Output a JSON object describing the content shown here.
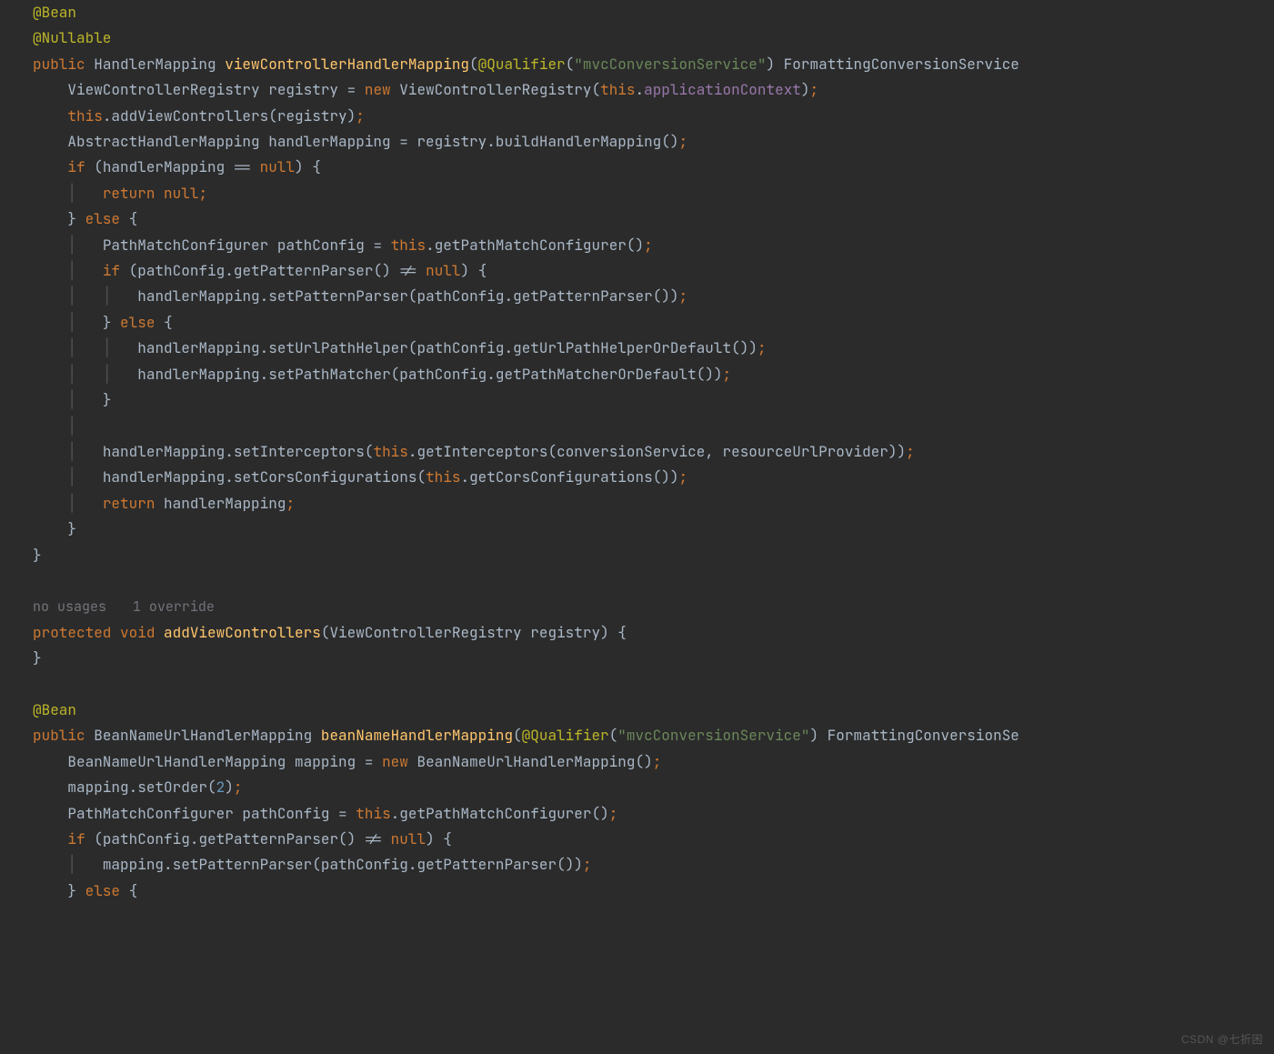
{
  "watermark": "CSDN @七折困",
  "hints": {
    "usages": "no usages",
    "overrides": "1 override"
  },
  "code": {
    "l1": {
      "ann": "@Bean"
    },
    "l2": {
      "ann": "@Nullable"
    },
    "l3": {
      "kw": "public",
      "ty1": "HandlerMapping",
      "fn": "viewControllerHandlerMapping",
      "ann": "@Qualifier",
      "str": "\"mvcConversionService\"",
      "tail": "FormattingConversionService"
    },
    "l4": {
      "ty": "ViewControllerRegistry",
      "var": "registry",
      "op": "=",
      "kw": "new",
      "ctor": "ViewControllerRegistry",
      "kw2": "this",
      "fld": "applicationContext"
    },
    "l5": {
      "kw": "this",
      "call": "addViewControllers",
      "arg": "registry"
    },
    "l6": {
      "ty": "AbstractHandlerMapping",
      "var": "handlerMapping",
      "op": "=",
      "rhs": "registry",
      "call": "buildHandlerMapping"
    },
    "l7": {
      "kw": "if",
      "lhs": "handlerMapping",
      "op": "==",
      "kw2": "null"
    },
    "l8": {
      "kw": "return",
      "kw2": "null"
    },
    "l9": {
      "kw": "else"
    },
    "l10": {
      "ty": "PathMatchConfigurer",
      "var": "pathConfig",
      "op": "=",
      "kw": "this",
      "call": "getPathMatchConfigurer"
    },
    "l11": {
      "kw": "if",
      "lhs": "pathConfig",
      "call": "getPatternParser",
      "op": "!=",
      "kw2": "null"
    },
    "l12": {
      "obj": "handlerMapping",
      "call": "setPatternParser",
      "arg": "pathConfig",
      "call2": "getPatternParser"
    },
    "l13": {
      "kw": "else"
    },
    "l14": {
      "obj": "handlerMapping",
      "call": "setUrlPathHelper",
      "arg": "pathConfig",
      "call2": "getUrlPathHelperOrDefault"
    },
    "l15": {
      "obj": "handlerMapping",
      "call": "setPathMatcher",
      "arg": "pathConfig",
      "call2": "getPathMatcherOrDefault"
    },
    "l16": {
      "obj": "handlerMapping",
      "call": "setInterceptors",
      "kw": "this",
      "call2": "getInterceptors",
      "args": "conversionService, resourceUrlProvider"
    },
    "l17": {
      "obj": "handlerMapping",
      "call": "setCorsConfigurations",
      "kw": "this",
      "call2": "getCorsConfigurations"
    },
    "l18": {
      "kw": "return",
      "obj": "handlerMapping"
    },
    "l19": {
      "kw": "protected",
      "kw2": "void",
      "fn": "addViewControllers",
      "ty": "ViewControllerRegistry",
      "arg": "registry"
    },
    "l20": {
      "ann": "@Bean"
    },
    "l21": {
      "kw": "public",
      "ty": "BeanNameUrlHandlerMapping",
      "fn": "beanNameHandlerMapping",
      "ann": "@Qualifier",
      "str": "\"mvcConversionService\"",
      "tail": "FormattingConversionSe"
    },
    "l22": {
      "ty": "BeanNameUrlHandlerMapping",
      "var": "mapping",
      "op": "=",
      "kw": "new",
      "ctor": "BeanNameUrlHandlerMapping"
    },
    "l23": {
      "obj": "mapping",
      "call": "setOrder",
      "num": "2"
    },
    "l24": {
      "ty": "PathMatchConfigurer",
      "var": "pathConfig",
      "op": "=",
      "kw": "this",
      "call": "getPathMatchConfigurer"
    },
    "l25": {
      "kw": "if",
      "lhs": "pathConfig",
      "call": "getPatternParser",
      "op": "!=",
      "kw2": "null"
    },
    "l26": {
      "obj": "mapping",
      "call": "setPatternParser",
      "arg": "pathConfig",
      "call2": "getPatternParser"
    },
    "l27": {
      "kw": "else"
    }
  }
}
